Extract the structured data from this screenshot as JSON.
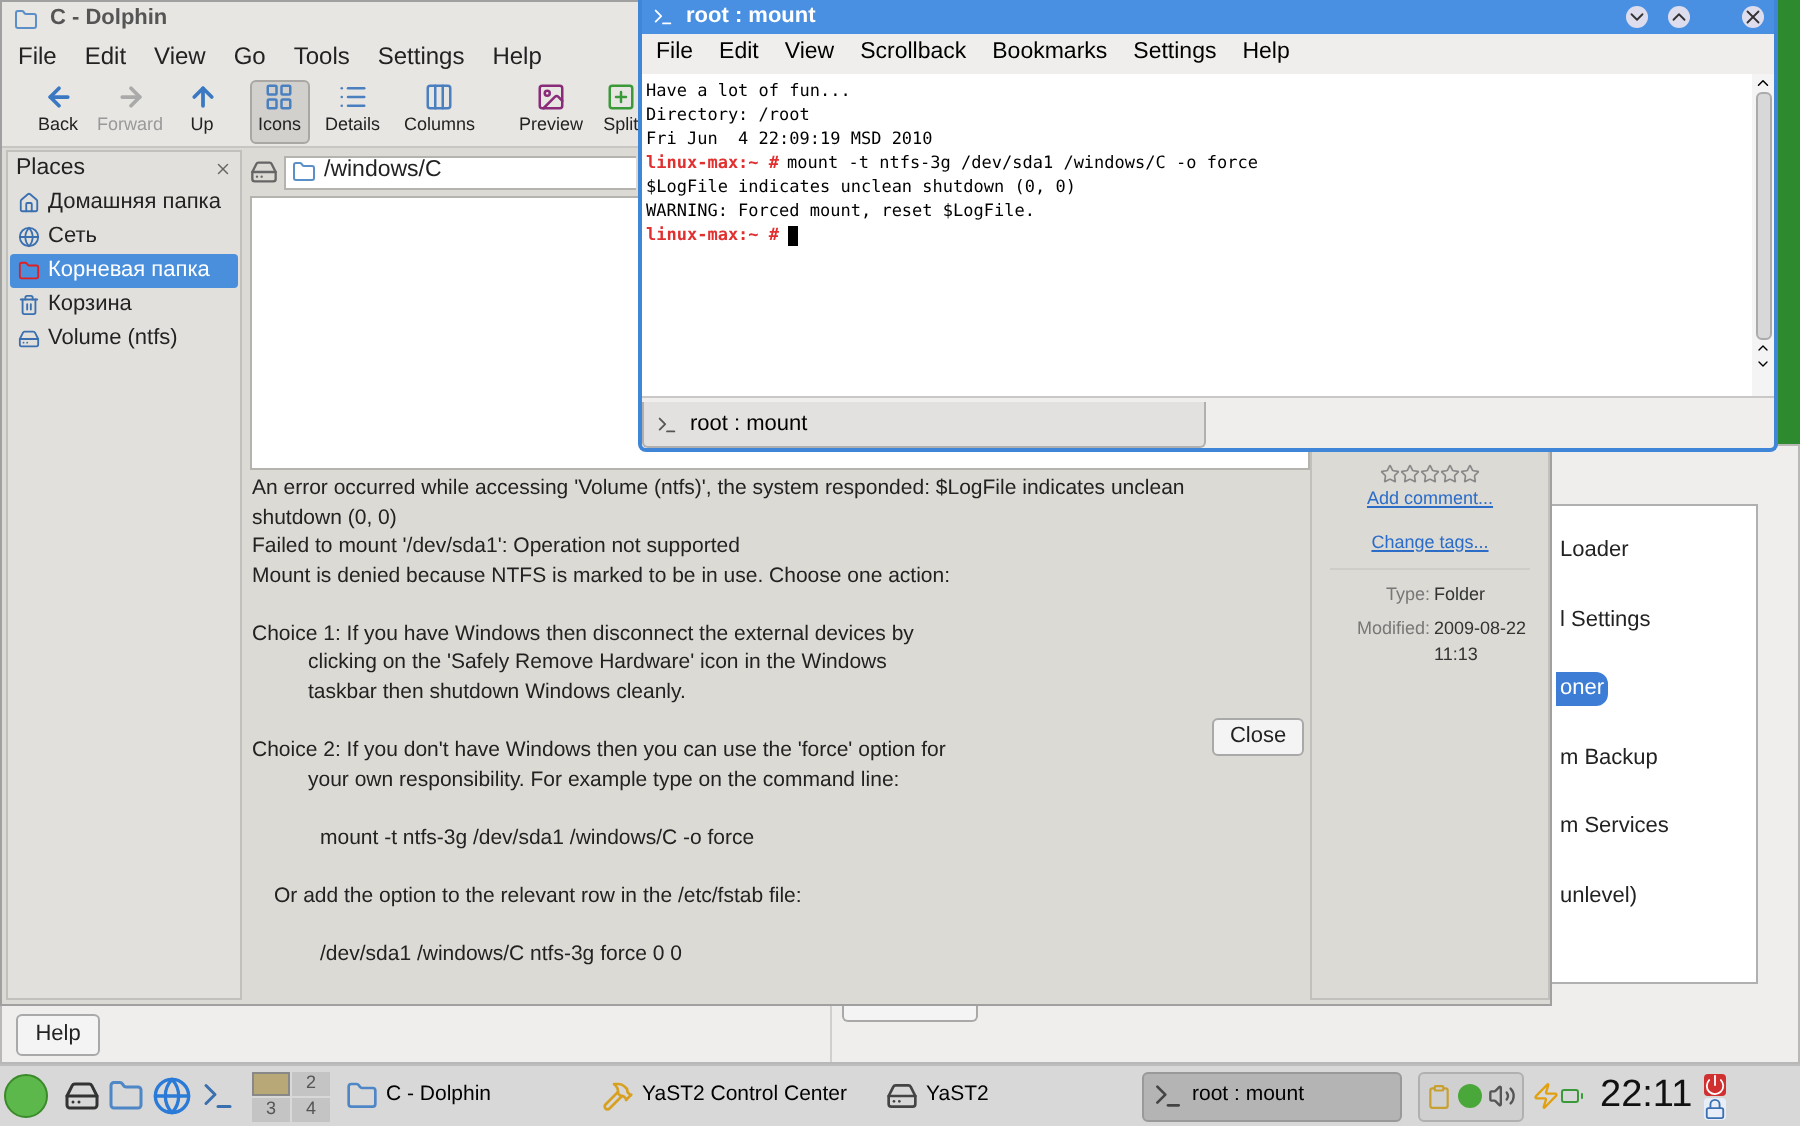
{
  "yast": {
    "items": [
      {
        "text": "Loader",
        "selected": false
      },
      {
        "text": "l Settings",
        "selected": false
      },
      {
        "text": "oner",
        "selected": true
      },
      {
        "text": "m Backup",
        "selected": false
      },
      {
        "text": "m Services",
        "selected": false
      },
      {
        "text": "unlevel)",
        "selected": false
      }
    ],
    "help_button": "Help"
  },
  "dolphin": {
    "title": "C - Dolphin",
    "menu": [
      "File",
      "Edit",
      "View",
      "Go",
      "Tools",
      "Settings",
      "Help"
    ],
    "navigation": [
      {
        "label": "Back",
        "kind": "back",
        "disabled": false
      },
      {
        "label": "Forward",
        "kind": "forward",
        "disabled": true
      },
      {
        "label": "Up",
        "kind": "up",
        "disabled": false
      }
    ],
    "view_modes": [
      {
        "label": "Icons",
        "kind": "icons",
        "selected": true
      },
      {
        "label": "Details",
        "kind": "details",
        "selected": false
      },
      {
        "label": "Columns",
        "kind": "columns",
        "selected": false
      }
    ],
    "actions": [
      {
        "label": "Preview",
        "kind": "preview"
      },
      {
        "label": "Split",
        "kind": "split"
      }
    ],
    "places": {
      "title": "Places",
      "items": [
        {
          "label": "Домашняя папка",
          "kind": "home",
          "selected": false
        },
        {
          "label": "Сеть",
          "kind": "network",
          "selected": false
        },
        {
          "label": "Корневая папка",
          "kind": "root",
          "selected": true
        },
        {
          "label": "Корзина",
          "kind": "trash",
          "selected": false
        },
        {
          "label": "Volume (ntfs)",
          "kind": "drive",
          "selected": false
        }
      ]
    },
    "location": "/windows/C",
    "error": {
      "paragraphs": [
        {
          "lines": [
            {
              "text": "An error occurred while accessing 'Volume (ntfs)', the system responded: $LogFile indicates unclean",
              "kind": "plain"
            },
            {
              "text": "shutdown (0, 0)",
              "kind": "plain"
            },
            {
              "text": "Failed to mount '/dev/sda1': Operation not supported",
              "kind": "plain"
            },
            {
              "text": "Mount is denied because NTFS is marked to be in use. Choose one action:",
              "kind": "plain"
            }
          ]
        },
        {
          "lines": [
            {
              "text": "Choice 1: If you have Windows then disconnect the external devices by",
              "kind": "plain"
            },
            {
              "text": "clicking on the 'Safely Remove Hardware' icon in the Windows",
              "kind": "indented"
            },
            {
              "text": "taskbar then shutdown Windows cleanly.",
              "kind": "indented"
            }
          ]
        },
        {
          "lines": [
            {
              "text": "Choice 2: If you don't have Windows then you can use the 'force' option for",
              "kind": "plain"
            },
            {
              "text": "your own responsibility. For example type on the command line:",
              "kind": "indented"
            }
          ]
        },
        {
          "lines": [
            {
              "text": "mount -t ntfs-3g /dev/sda1 /windows/C -o force",
              "kind": "command"
            }
          ]
        },
        {
          "lines": [
            {
              "text": "Or add the option to the relevant row in the /etc/fstab file:",
              "kind": "note"
            }
          ]
        },
        {
          "lines": [
            {
              "text": "/dev/sda1 /windows/C ntfs-3g force 0 0",
              "kind": "command"
            }
          ]
        }
      ],
      "close_button": "Close"
    },
    "info": {
      "stars": 0,
      "links": [
        "Add comment...",
        "Change tags..."
      ],
      "fields": [
        {
          "label": "Type:",
          "value": "Folder"
        },
        {
          "label": "Modified:",
          "value": "2009-08-22 11:13"
        }
      ]
    }
  },
  "terminal": {
    "title": "root : mount",
    "menu": [
      "File",
      "Edit",
      "View",
      "Scrollback",
      "Bookmarks",
      "Settings",
      "Help"
    ],
    "lines": [
      {
        "text": "Have a lot of fun..."
      },
      {
        "text": "Directory: /root"
      },
      {
        "text": "Fri Jun  4 22:09:19 MSD 2010"
      },
      {
        "prompt": "linux-max:~ #",
        "text": "mount -t ntfs-3g /dev/sda1 /windows/C -o force"
      },
      {
        "text": "$LogFile indicates unclean shutdown (0, 0)"
      },
      {
        "text": "WARNING: Forced mount, reset $LogFile."
      },
      {
        "prompt": "linux-max:~ #",
        "cursor": true
      }
    ],
    "tabs": [
      {
        "label": "root : mount",
        "selected": true
      }
    ]
  },
  "taskbar": {
    "pager": [
      {
        "selected": true
      },
      {
        "label": "2",
        "selected": false
      },
      {
        "label": "3",
        "selected": false
      },
      {
        "label": "4",
        "selected": false
      }
    ],
    "tasks": [
      {
        "label": "C - Dolphin",
        "kind": "folder",
        "selected": false
      },
      {
        "label": "YaST2 Control Center",
        "kind": "hammer",
        "selected": false
      },
      {
        "label": "YaST2",
        "kind": "disk",
        "selected": false
      },
      {
        "label": "root : mount",
        "kind": "terminal",
        "selected": true
      }
    ],
    "clock": "22:11"
  }
}
